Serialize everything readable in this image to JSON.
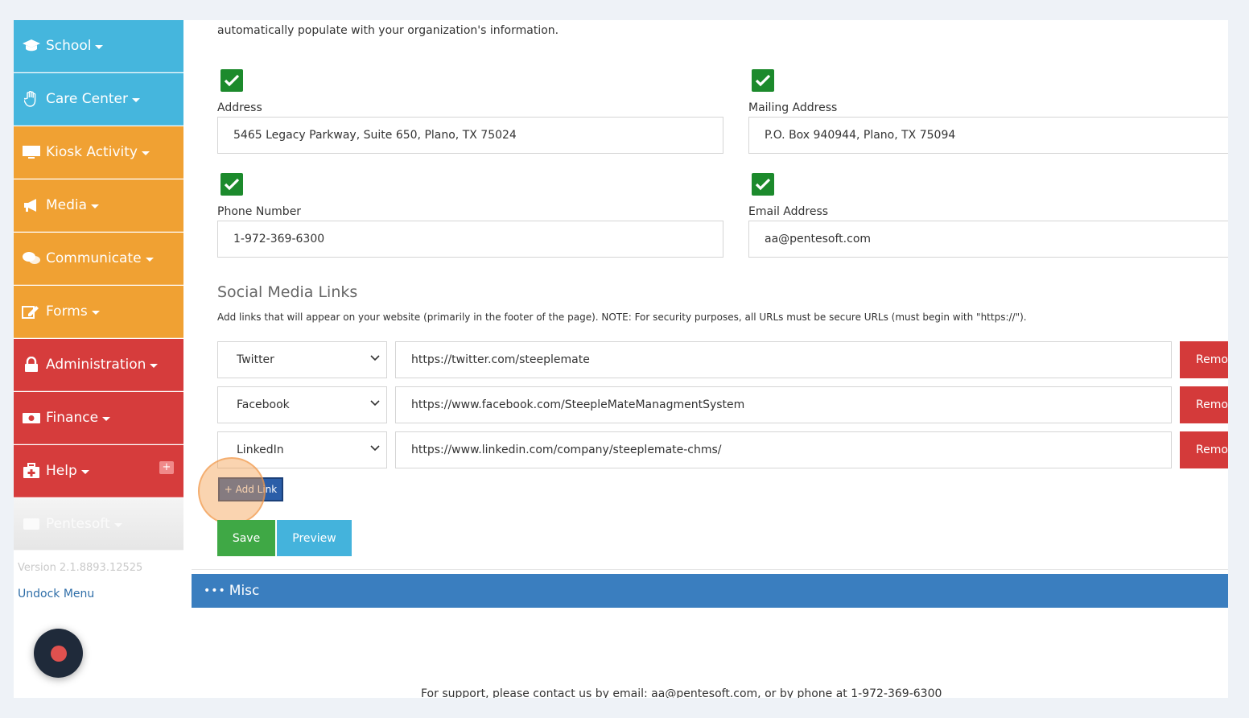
{
  "sidebar": {
    "items": [
      {
        "label": "School",
        "icon": "graduation-cap-icon"
      },
      {
        "label": "Care Center",
        "icon": "hand-icon"
      },
      {
        "label": "Kiosk Activity",
        "icon": "monitor-icon"
      },
      {
        "label": "Media",
        "icon": "megaphone-icon"
      },
      {
        "label": "Communicate",
        "icon": "chat-bubbles-icon"
      },
      {
        "label": "Forms",
        "icon": "edit-form-icon"
      },
      {
        "label": "Administration",
        "icon": "lock-icon"
      },
      {
        "label": "Finance",
        "icon": "money-icon"
      },
      {
        "label": "Help",
        "icon": "first-aid-kit-icon"
      },
      {
        "label": "Pentesoft",
        "icon": "user-icon"
      }
    ],
    "help_badge": "+",
    "version": "Version 2.1.8893.12525",
    "undock": "Undock Menu"
  },
  "intro_text": "automatically populate with your organization's information.",
  "fields": {
    "address": {
      "label": "Address",
      "value": "5465 Legacy Parkway, Suite 650, Plano, TX 75024",
      "checked": true
    },
    "mailing": {
      "label": "Mailing Address",
      "value": "P.O. Box 940944, Plano, TX 75094",
      "checked": true
    },
    "phone": {
      "label": "Phone Number",
      "value": "1-972-369-6300",
      "checked": true
    },
    "email": {
      "label": "Email Address",
      "value": "aa@pentesoft.com",
      "checked": true
    }
  },
  "social": {
    "title": "Social Media Links",
    "note": "Add links that will appear on your website (primarily in the footer of the page). NOTE: For security purposes, all URLs must be secure URLs (must begin with \"https://\").",
    "links": [
      {
        "platform": "Twitter",
        "url": "https://twitter.com/steeplemate",
        "remove": "Remove"
      },
      {
        "platform": "Facebook",
        "url": "https://www.facebook.com/SteepleMateManagmentSystem",
        "remove": "Remove"
      },
      {
        "platform": "LinkedIn",
        "url": "https://www.linkedin.com/company/steeplemate-chms/",
        "remove": "Remove"
      }
    ],
    "add_link": "+ Add Link"
  },
  "actions": {
    "save": "Save",
    "preview": "Preview"
  },
  "misc": {
    "dots": "•••",
    "label": "Misc"
  },
  "support": "For support, please contact us by email: aa@pentesoft.com, or by phone at 1-972-369-6300"
}
